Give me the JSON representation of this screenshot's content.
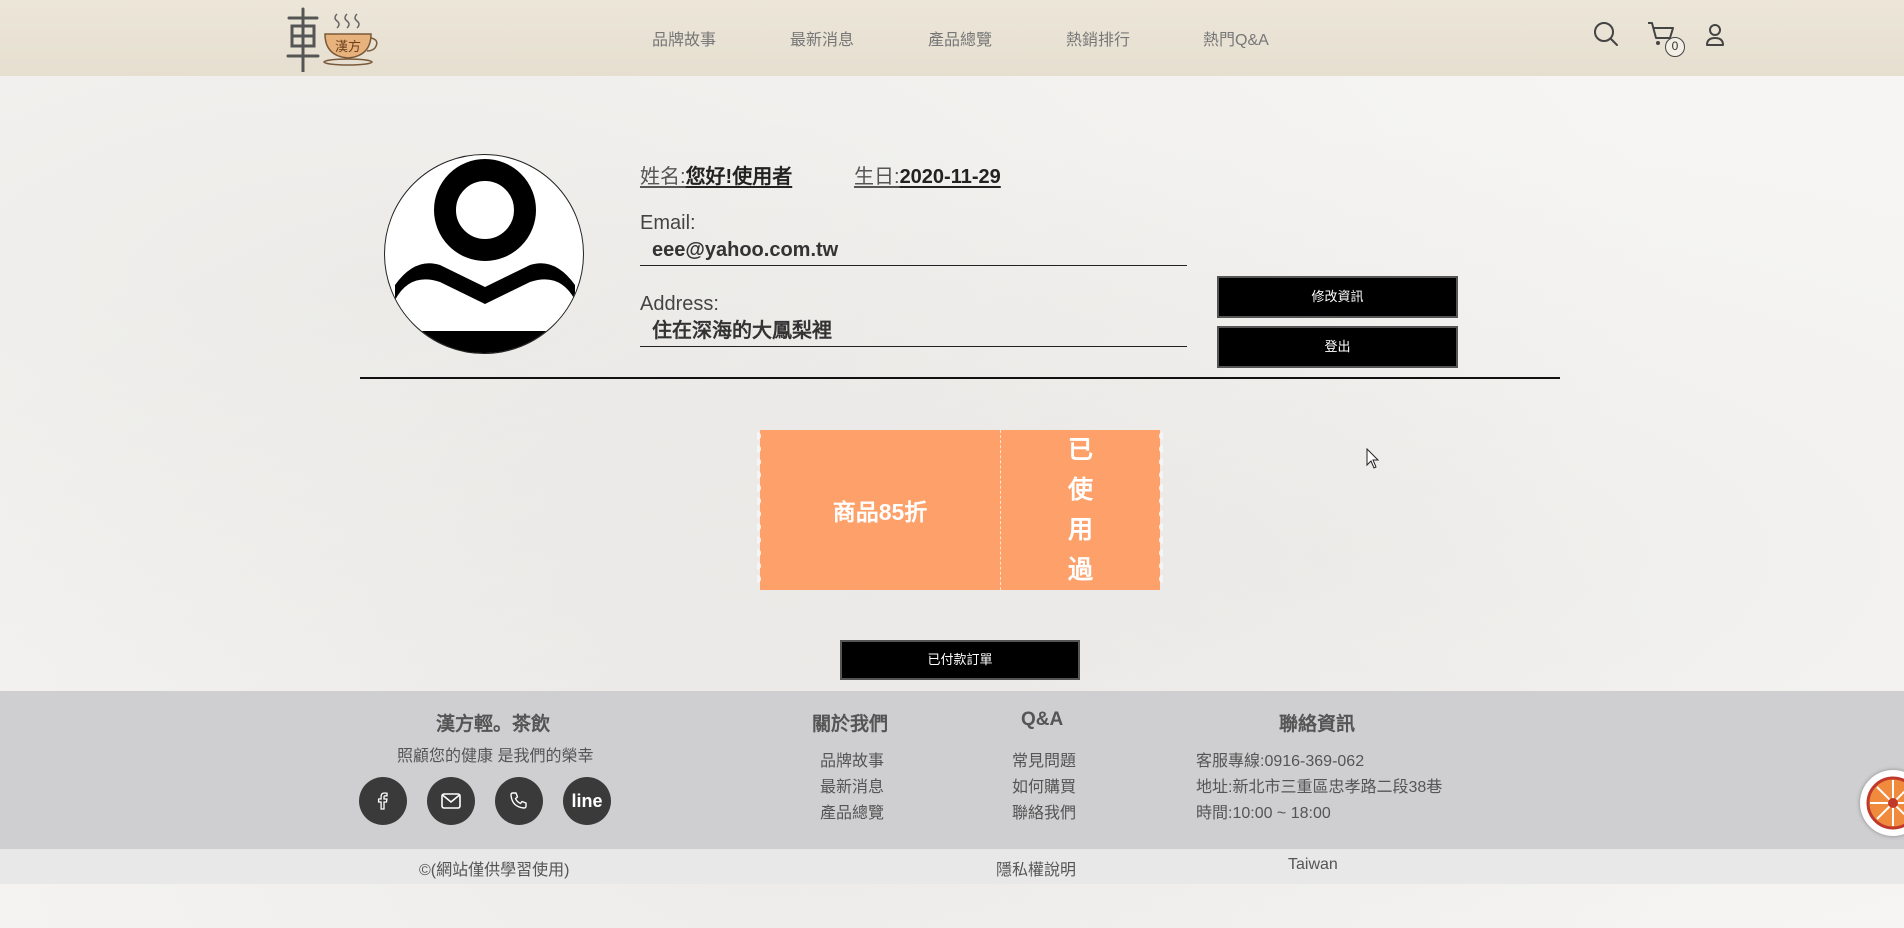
{
  "header": {
    "logo_text": "漢方",
    "nav": [
      "品牌故事",
      "最新消息",
      "產品總覽",
      "熱銷排行",
      "熱門Q&A"
    ],
    "cart_count": "0",
    "icons": [
      "search-icon",
      "cart-icon",
      "user-icon"
    ]
  },
  "profile": {
    "name_label": "姓名:",
    "name_value": "您好!使用者",
    "birthday_label": "生日:",
    "birthday_value": "2020-11-29",
    "email_label": "Email:",
    "email_value": "eee@yahoo.com.tw",
    "address_label": "Address:",
    "address_value": "住在深海的大鳳梨裡",
    "edit_button": "修改資訊",
    "logout_button": "登出"
  },
  "coupon": {
    "title": "商品85折",
    "status": "已使用過",
    "color": "#fda06a"
  },
  "orders_button": "已付款訂單",
  "footer": {
    "brand": {
      "title": "漢方輕。茶飲",
      "slogan": "照顧您的健康 是我們的榮幸",
      "social": [
        "facebook-icon",
        "mail-icon",
        "phone-icon",
        "line"
      ]
    },
    "about": {
      "title": "關於我們",
      "links": [
        "品牌故事",
        "最新消息",
        "產品總覽"
      ]
    },
    "qa": {
      "title": "Q&A",
      "links": [
        "常見問題",
        "如何購買",
        "聯絡我們"
      ]
    },
    "contact": {
      "title": "聯絡資訊",
      "lines": [
        "客服專線:0916-369-062",
        "地址:新北市三重區忠孝路二段38巷",
        "時間:10:00 ~ 18:00"
      ]
    }
  },
  "bottom_bar": {
    "copyright": "©(網站僅供學習使用)",
    "privacy": "隱私權說明",
    "region": "Taiwan"
  }
}
